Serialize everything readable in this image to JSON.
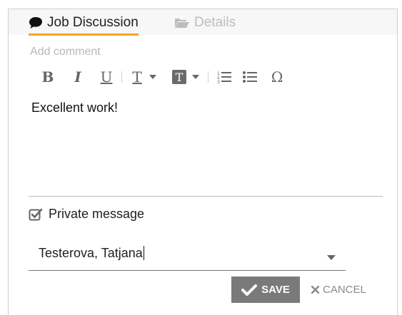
{
  "tabs": [
    {
      "label": "Job Discussion",
      "icon": "comment-icon",
      "active": true
    },
    {
      "label": "Details",
      "icon": "folder-open-icon",
      "active": false
    }
  ],
  "editor": {
    "placeholder": "Add comment",
    "content": "Excellent work!",
    "toolbar": {
      "bold": "B",
      "italic": "I",
      "underline": "U",
      "text_color": "T",
      "background_color": "T",
      "special_char": "Ω"
    }
  },
  "private_message": {
    "label": "Private message",
    "checked": true
  },
  "recipient": {
    "value": "Testerova, Tatjana"
  },
  "actions": {
    "save_label": "SAVE",
    "cancel_label": "CANCEL"
  },
  "colors": {
    "accent_underline": "#f5a623",
    "save_bg": "#7a7a7a"
  }
}
